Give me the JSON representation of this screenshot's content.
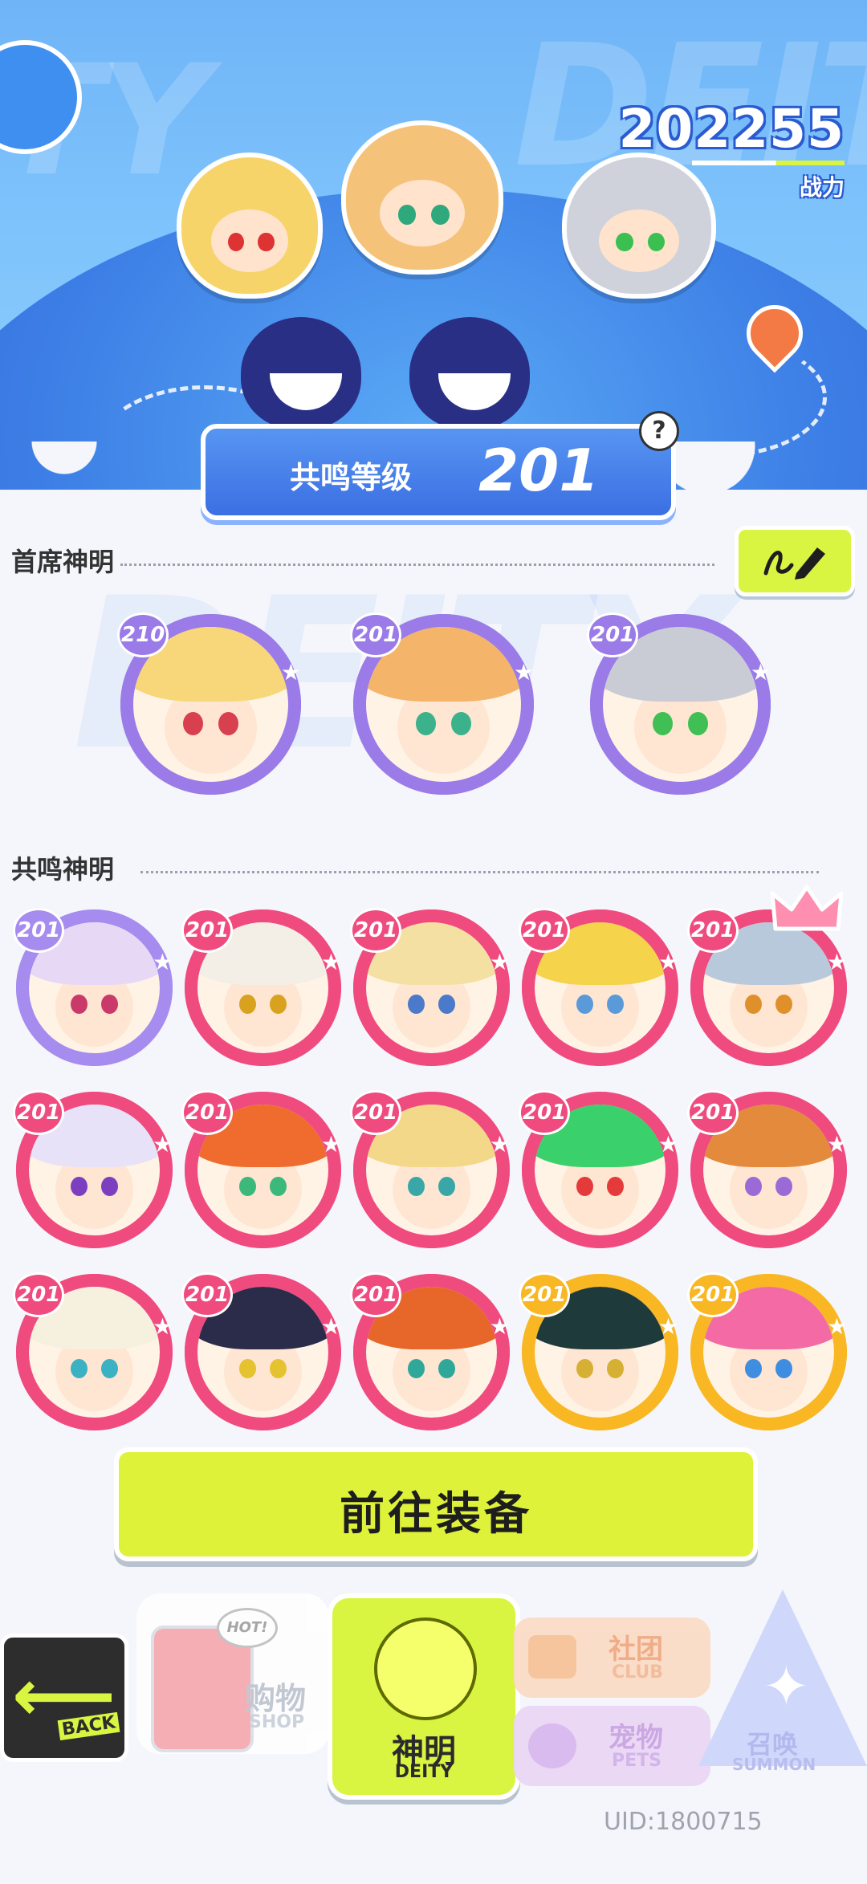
{
  "power": {
    "value": "202255",
    "label": "战力"
  },
  "resonance": {
    "label": "共鸣等级",
    "level": "201",
    "help": "?"
  },
  "background_words": {
    "left": "TY",
    "right": "DEIT",
    "watermark": "DEITY"
  },
  "sections": {
    "chief": {
      "title": "首席神明",
      "deities": [
        {
          "level": "210",
          "hair": "#f7d77a",
          "eye": "#d8404f",
          "ring": "#9a7be8"
        },
        {
          "level": "201",
          "hair": "#f4b46a",
          "eye": "#3bb28c",
          "ring": "#9a7be8"
        },
        {
          "level": "201",
          "hair": "#c9ccd4",
          "eye": "#3fbf54",
          "ring": "#9a7be8"
        }
      ]
    },
    "resonance": {
      "title": "共鸣神明",
      "deities": [
        {
          "level": "201",
          "hair": "#e7d9f6",
          "eye": "#c93a6a",
          "ring": "#a78cf0",
          "tier": "purple"
        },
        {
          "level": "201",
          "hair": "#f3efe6",
          "eye": "#d9a21e",
          "ring": "#f04b7f",
          "tier": "red"
        },
        {
          "level": "201",
          "hair": "#f5e0a3",
          "eye": "#4a7ac9",
          "ring": "#f04b7f",
          "tier": "red"
        },
        {
          "level": "201",
          "hair": "#f5d34a",
          "eye": "#5a9ad8",
          "ring": "#f04b7f",
          "tier": "red"
        },
        {
          "level": "201",
          "hair": "#b9c9dc",
          "eye": "#e0902a",
          "ring": "#f04b7f",
          "tier": "red"
        },
        {
          "level": "201",
          "hair": "#e8e2f8",
          "eye": "#7b3fc0",
          "ring": "#f04b7f",
          "tier": "red"
        },
        {
          "level": "201",
          "hair": "#ef6c2e",
          "eye": "#3db87b",
          "ring": "#f04b7f",
          "tier": "red"
        },
        {
          "level": "201",
          "hair": "#f3d88a",
          "eye": "#39a7a7",
          "ring": "#f04b7f",
          "tier": "red"
        },
        {
          "level": "201",
          "hair": "#3ad06b",
          "eye": "#e53a3a",
          "ring": "#f04b7f",
          "tier": "red"
        },
        {
          "level": "201",
          "hair": "#e38a3c",
          "eye": "#9b6ad6",
          "ring": "#f04b7f",
          "tier": "red"
        },
        {
          "level": "201",
          "hair": "#f6f1df",
          "eye": "#3bb2c4",
          "ring": "#f04b7f",
          "tier": "red"
        },
        {
          "level": "201",
          "hair": "#2b2c4a",
          "eye": "#e5c230",
          "ring": "#f04b7f",
          "tier": "red"
        },
        {
          "level": "201",
          "hair": "#e7662a",
          "eye": "#2fa89a",
          "ring": "#f04b7f",
          "tier": "red"
        },
        {
          "level": "201",
          "hair": "#1f3a3a",
          "eye": "#d6b034",
          "ring": "#f8b723",
          "tier": "gold"
        },
        {
          "level": "201",
          "hair": "#f36aa5",
          "eye": "#3f8de0",
          "ring": "#f8b723",
          "tier": "gold"
        }
      ]
    }
  },
  "equip_button": "前往装备",
  "nav": {
    "back": "BACK",
    "shop": {
      "main": "购物",
      "sub": "SHOP",
      "hot": "HOT!"
    },
    "deity": {
      "main": "神明",
      "sub": "DEITY"
    },
    "club": {
      "main": "社团",
      "sub": "CLUB"
    },
    "pets": {
      "main": "宠物",
      "sub": "PETS"
    },
    "summon": {
      "main": "召唤",
      "sub": "SUMMON"
    }
  },
  "uid": "UID:1800715",
  "colors": {
    "accent": "#d9f542",
    "primary_blue": "#3b6fe3"
  }
}
